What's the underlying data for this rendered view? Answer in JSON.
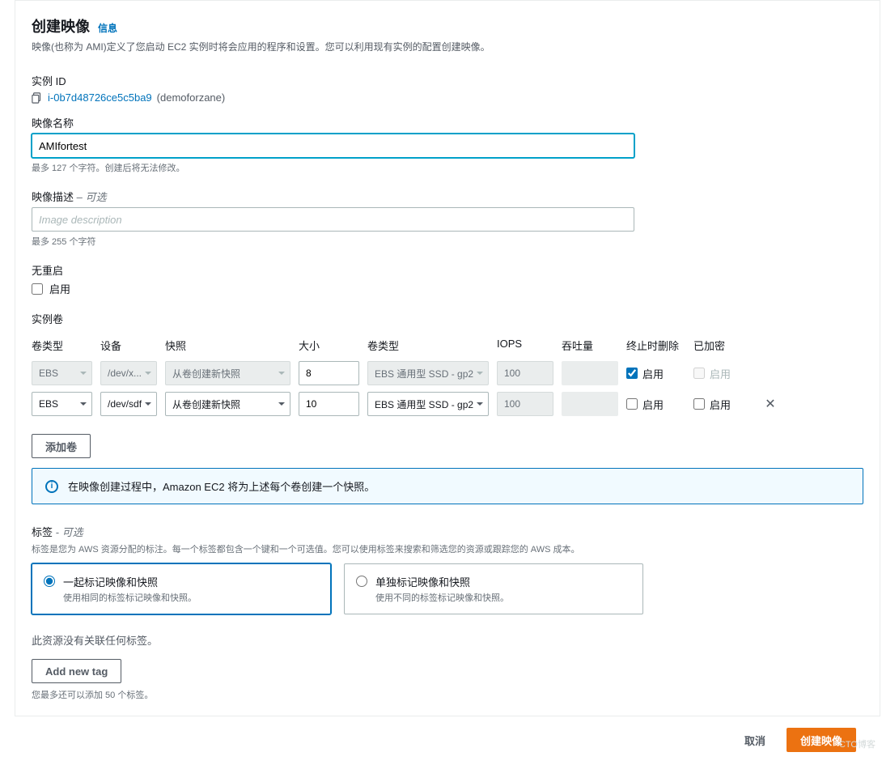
{
  "header": {
    "title": "创建映像",
    "info_link": "信息",
    "subtitle": "映像(也称为 AMI)定义了您启动 EC2 实例时将会应用的程序和设置。您可以利用现有实例的配置创建映像。"
  },
  "instance": {
    "label": "实例 ID",
    "id": "i-0b7d48726ce5c5ba9",
    "name": "(demoforzane)"
  },
  "image_name": {
    "label": "映像名称",
    "value": "AMIfortest",
    "hint": "最多 127 个字符。创建后将无法修改。"
  },
  "image_desc": {
    "label": "映像描述",
    "optional": "– 可选",
    "placeholder": "Image description",
    "hint": "最多 255 个字符"
  },
  "no_reboot": {
    "label": "无重启",
    "enable": "启用"
  },
  "volumes": {
    "label": "实例卷",
    "headers": {
      "type": "卷类型",
      "device": "设备",
      "snapshot": "快照",
      "size": "大小",
      "vtype": "卷类型",
      "iops": "IOPS",
      "throughput": "吞吐量",
      "delete": "终止时删除",
      "encrypted": "已加密"
    },
    "rows": [
      {
        "type": "EBS",
        "device": "/dev/x...",
        "snapshot": "从卷创建新快照",
        "size": "8",
        "vtype": "EBS 通用型 SSD - gp2",
        "iops": "100",
        "delete_checked": true,
        "delete_label": "启用",
        "enc_disabled": true,
        "enc_label": "启用",
        "removable": false,
        "disabled": true
      },
      {
        "type": "EBS",
        "device": "/dev/sdf",
        "snapshot": "从卷创建新快照",
        "size": "10",
        "vtype": "EBS 通用型 SSD - gp2",
        "iops": "100",
        "delete_checked": false,
        "delete_label": "启用",
        "enc_disabled": false,
        "enc_label": "启用",
        "removable": true,
        "disabled": false
      }
    ],
    "add_button": "添加卷"
  },
  "alert": "在映像创建过程中，Amazon EC2 将为上述每个卷创建一个快照。",
  "tags": {
    "label": "标签",
    "optional": "- 可选",
    "desc": "标签是您为 AWS 资源分配的标注。每一个标签都包含一个键和一个可选值。您可以使用标签来搜索和筛选您的资源或跟踪您的 AWS 成本。",
    "option_a_title": "一起标记映像和快照",
    "option_a_desc": "使用相同的标签标记映像和快照。",
    "option_b_title": "单独标记映像和快照",
    "option_b_desc": "使用不同的标签标记映像和快照。",
    "no_tags": "此资源没有关联任何标签。",
    "add_tag": "Add new tag",
    "limit": "您最多还可以添加 50 个标签。"
  },
  "footer": {
    "cancel": "取消",
    "create": "创建映像"
  },
  "watermark": "CTO博客"
}
